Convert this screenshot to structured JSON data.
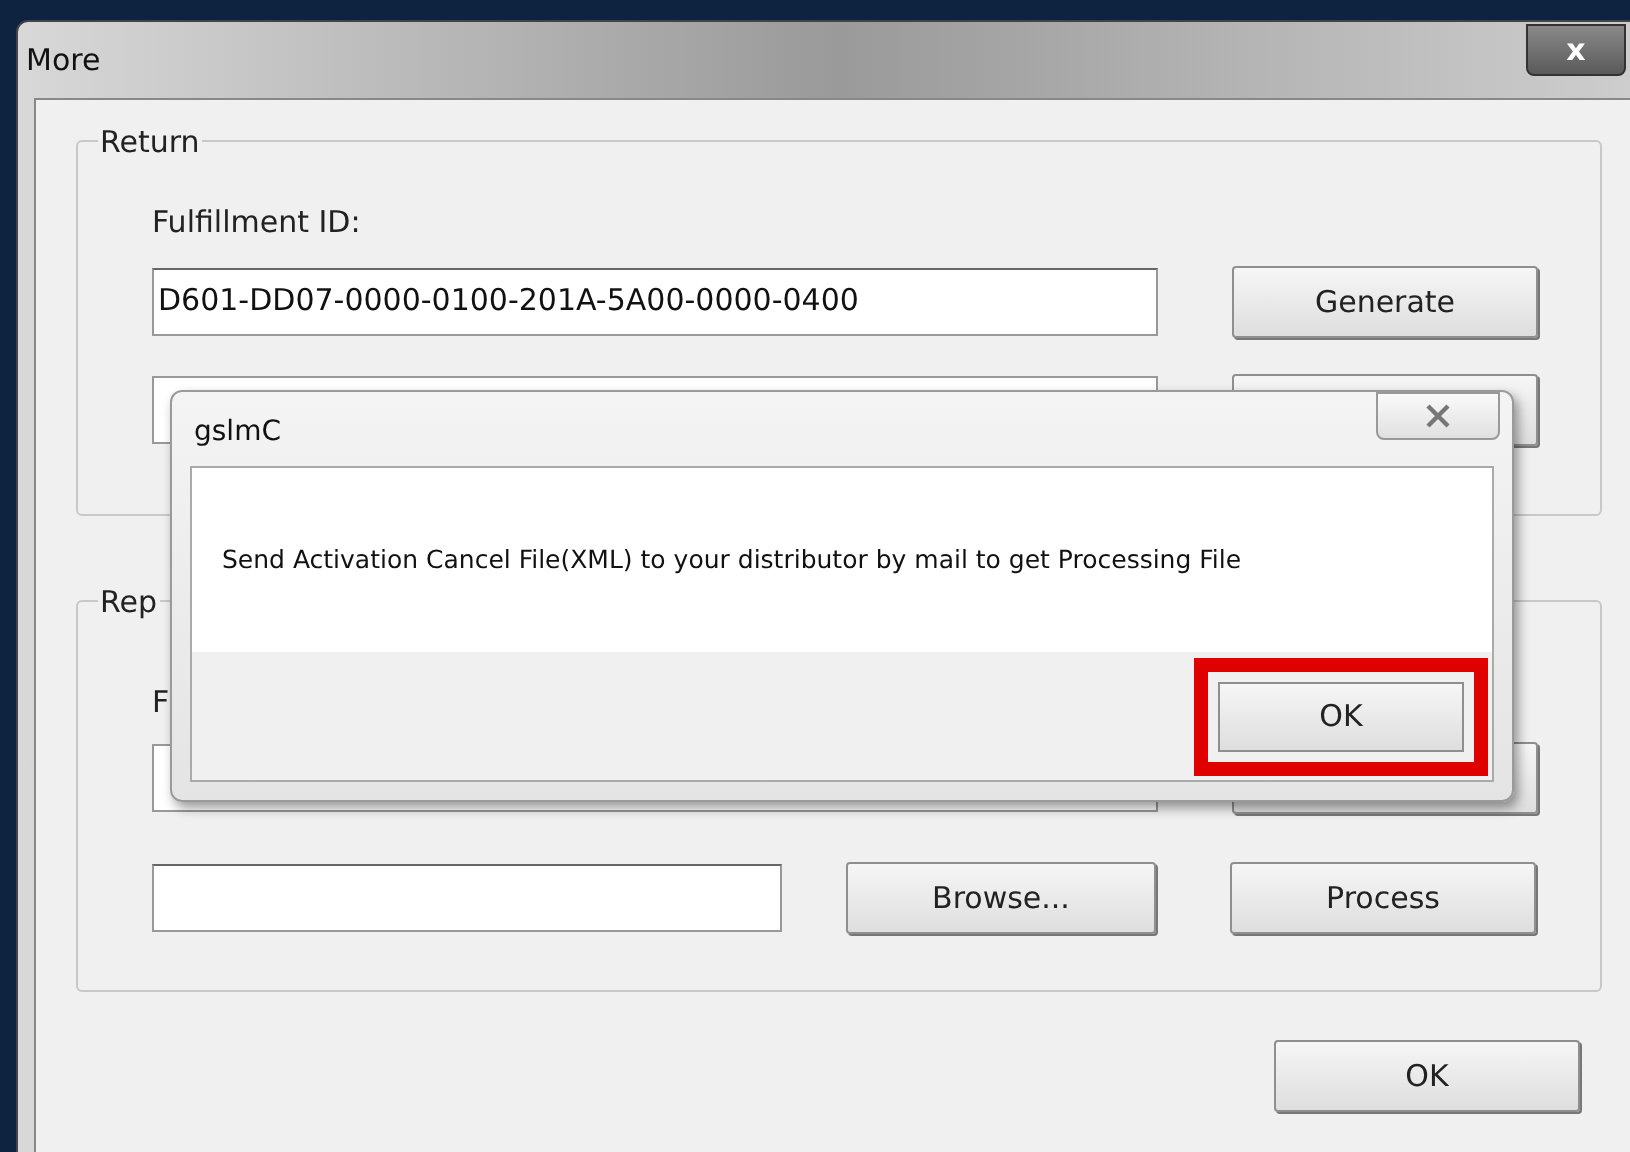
{
  "window": {
    "title": "More",
    "close": "x"
  },
  "return_group": {
    "legend": "Return",
    "label": "Fulfillment ID:",
    "id_value": "D601-DD07-0000-0100-201A-5A00-0000-0400",
    "generate": "Generate"
  },
  "replace_group": {
    "legend": "Rep",
    "label": "F",
    "browse": "Browse...",
    "process": "Process"
  },
  "ok": "OK",
  "dialog": {
    "title": "gslmC",
    "message": "Send Activation Cancel File(XML) to your distributor by mail to get Processing File",
    "ok": {
      "label": "OK",
      "highlighted": true
    }
  }
}
